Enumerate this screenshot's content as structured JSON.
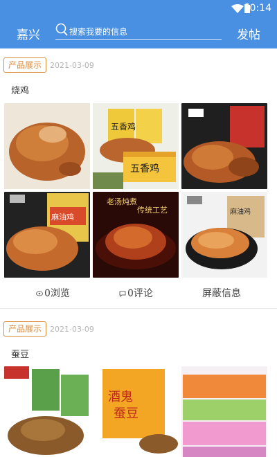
{
  "status_bar": {
    "time": "10:14"
  },
  "header": {
    "city": "嘉兴",
    "search_placeholder": "搜索我要的信息",
    "post_label": "发帖"
  },
  "posts": [
    {
      "tag": "产品展示",
      "date": "2021-03-09",
      "title": "烧鸡",
      "images": [
        {
          "label": ""
        },
        {
          "label": "五香鸡"
        },
        {
          "label": ""
        },
        {
          "label": "麻油鸡"
        },
        {
          "label": "老汤炖煮 传统工艺"
        },
        {
          "label": "麻油鸡"
        }
      ],
      "actions": {
        "views": "0浏览",
        "comments": "0评论",
        "block": "屏蔽信息"
      }
    },
    {
      "tag": "产品展示",
      "date": "2021-03-09",
      "title": "蚕豆"
    }
  ],
  "colors": {
    "accent": "#4a90e2",
    "tag": "#d98a3a"
  }
}
